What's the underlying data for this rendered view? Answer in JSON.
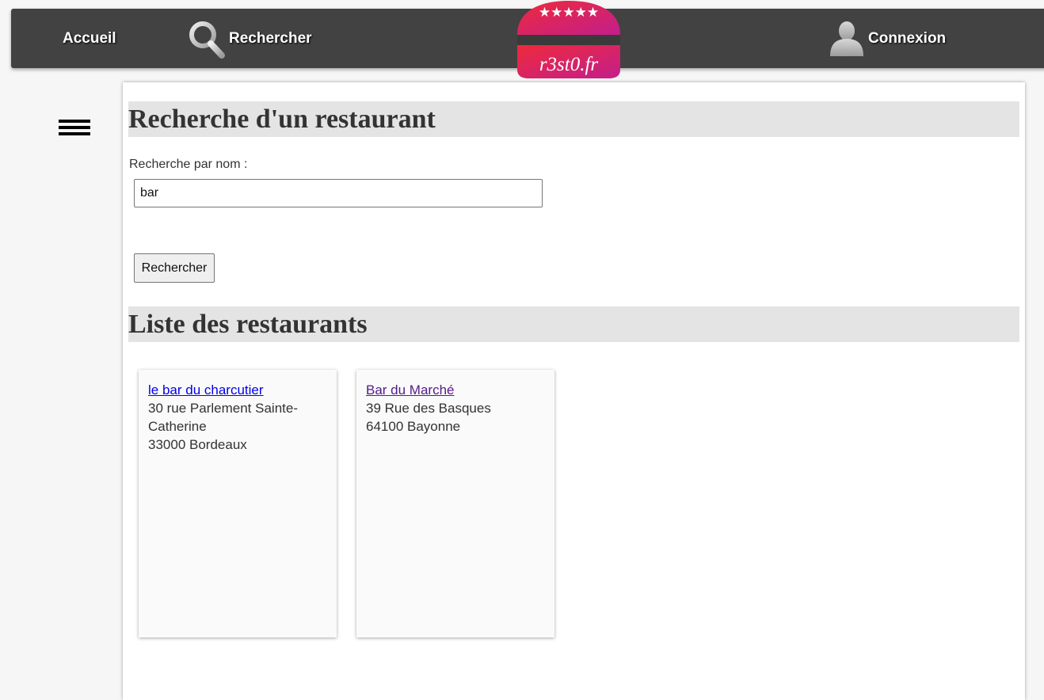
{
  "nav": {
    "home_label": "Accueil",
    "search_label": "Rechercher",
    "login_label": "Connexion",
    "search_icon": "search-icon",
    "login_icon": "user-icon"
  },
  "logo": {
    "text": "r3st0.fr",
    "stars": "★★★★★"
  },
  "menu": {
    "icon": "hamburger-menu-icon"
  },
  "search_section": {
    "title": "Recherche d'un restaurant",
    "label": "Recherche par nom :",
    "input_value": "bar",
    "button_label": "Rechercher"
  },
  "results_section": {
    "title": "Liste des restaurants",
    "restaurants": [
      {
        "name": "le bar du charcutier",
        "street": "30 rue Parlement Sainte-Catherine",
        "city": "33000 Bordeaux",
        "link_color": "#0000ee"
      },
      {
        "name": "Bar du Marché",
        "street": "39 Rue des Basques",
        "city": "64100 Bayonne",
        "link_color": "#551a8b"
      }
    ]
  },
  "colors": {
    "topbar": "#424242",
    "logo_gradient_top": "#e8243c",
    "logo_gradient_bottom": "#c41e8a",
    "section_title_bg": "#e4e4e4"
  }
}
